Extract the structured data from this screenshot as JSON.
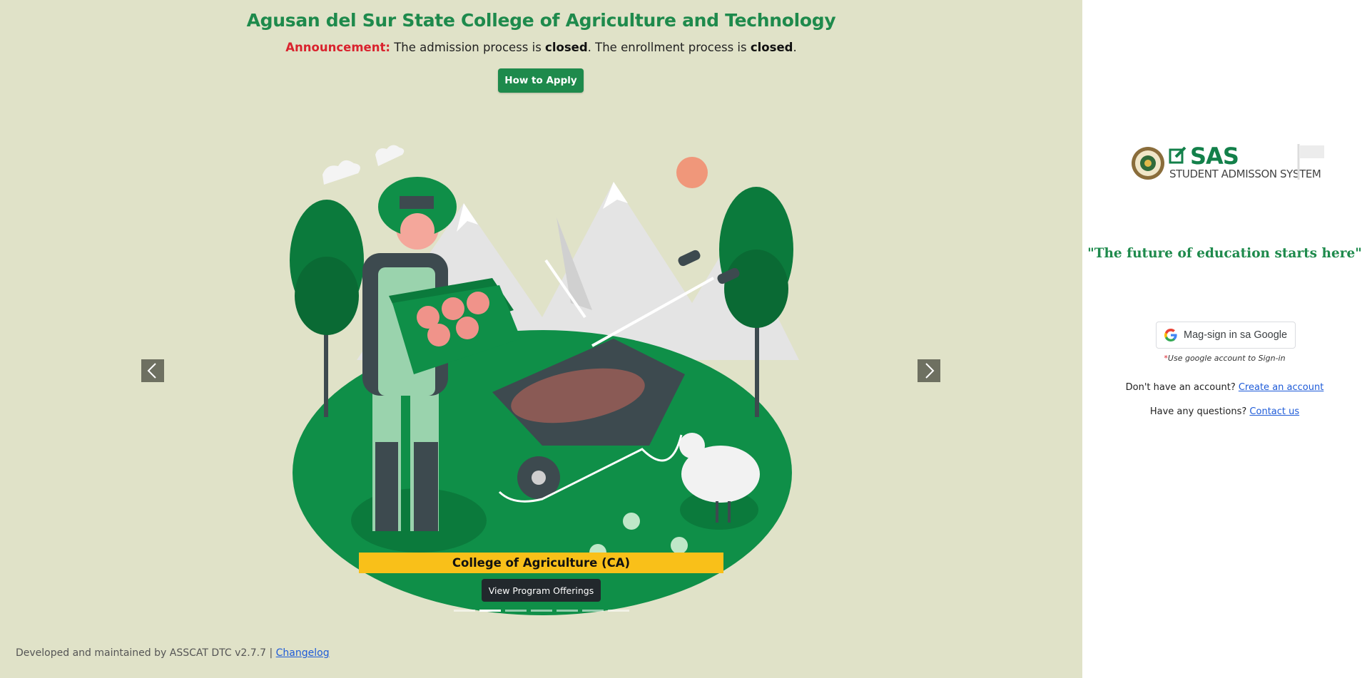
{
  "header": {
    "title": "Agusan del Sur State College of Agriculture and Technology",
    "announcement_label": "Announcement:",
    "announcement_part1": " The admission process is ",
    "admission_status": "closed",
    "announcement_part2": ". The enrollment process is ",
    "enrollment_status": "closed",
    "announcement_end": ".",
    "how_to_apply_label": "How to Apply"
  },
  "carousel": {
    "caption": "College of Agriculture (CA)",
    "view_button_label": "View Program Offerings",
    "indicator_count": 7,
    "active_index": 1,
    "prev_icon": "chevron-left-icon",
    "next_icon": "chevron-right-icon"
  },
  "footer": {
    "text": "Developed and maintained by ASSCAT DTC v2.7.7 | ",
    "changelog_label": "Changelog"
  },
  "sidebar": {
    "logo_big": "SAS",
    "logo_small": "STUDENT ADMISSON SYSTEM",
    "tagline": "\"The future of education starts here\"",
    "google_button_label": "Mag-sign in sa Google",
    "note_star": "*",
    "note_text": "Use google account to Sign-in",
    "no_account_text": "Don't have an account? ",
    "create_account_label": "Create an account",
    "questions_text": "Have any questions? ",
    "contact_label": "Contact us"
  },
  "colors": {
    "brand_green": "#1e8a4c",
    "left_bg": "#e0e2c8",
    "caption_yellow": "#f9c019",
    "announcement_red": "#d9232e"
  }
}
